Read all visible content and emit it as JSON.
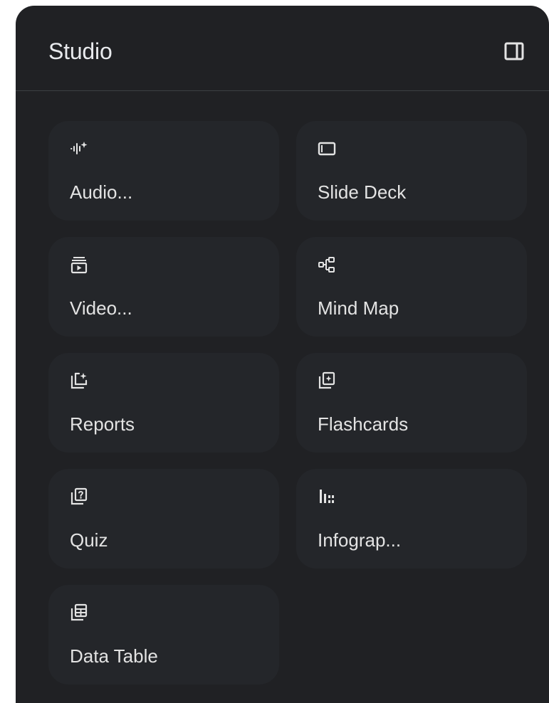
{
  "header": {
    "title": "Studio",
    "toggle_icon": "side-panel-icon"
  },
  "colors": {
    "panel_background": "#202124",
    "card_background": "#24262a",
    "text": "#e3e3e3",
    "icon": "#e3e3e3"
  },
  "tools": [
    {
      "label": "Audio...",
      "icon": "audio-sparkle-icon"
    },
    {
      "label": "Slide Deck",
      "icon": "slide-deck-icon"
    },
    {
      "label": "Video...",
      "icon": "video-icon"
    },
    {
      "label": "Mind Map",
      "icon": "mind-map-icon"
    },
    {
      "label": "Reports",
      "icon": "reports-icon"
    },
    {
      "label": "Flashcards",
      "icon": "flashcards-icon"
    },
    {
      "label": "Quiz",
      "icon": "quiz-icon"
    },
    {
      "label": "Infograp...",
      "icon": "infographic-icon"
    },
    {
      "label": "Data Table",
      "icon": "data-table-icon"
    }
  ]
}
